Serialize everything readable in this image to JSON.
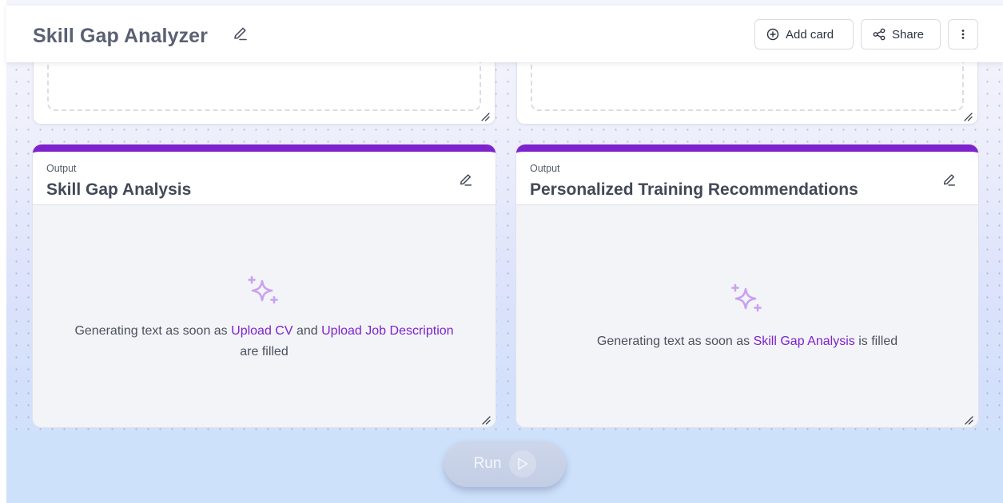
{
  "header": {
    "title": "Skill Gap Analyzer",
    "add_card_label": "Add card",
    "share_label": "Share",
    "icons": [
      "pencil-icon",
      "plus-circle-icon",
      "share-icon",
      "more-vertical-icon"
    ]
  },
  "cards": [
    {
      "kicker": "Output",
      "title": "Skill Gap Analysis",
      "text_prefix": "Generating text as soon as",
      "link_1": "Upload CV",
      "joiner": "and",
      "link_2": "Upload Job Description",
      "text_suffix": "are filled"
    },
    {
      "kicker": "Output",
      "title": "Personalized Training Recommendations",
      "text_prefix": "Generating text as soon as",
      "link_1": "Skill Gap Analysis",
      "text_suffix": "is filled"
    }
  ],
  "run": {
    "label": "Run"
  },
  "colors": {
    "accent": "#7e22ce",
    "title": "#5a6173",
    "sparkle": "#c9a2f2",
    "card_body": "#f3f4f7"
  }
}
